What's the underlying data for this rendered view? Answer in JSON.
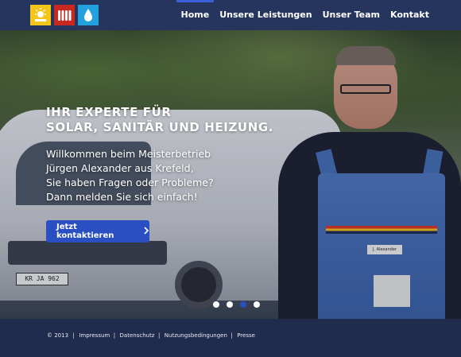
{
  "nav": {
    "logo_icons": [
      "sun-icon",
      "radiator-icon",
      "water-drop-icon"
    ],
    "logo_colors": [
      "#f4c61a",
      "#c8281f",
      "#22a1dd"
    ],
    "items": [
      {
        "label": "Home",
        "active": true
      },
      {
        "label": "Unsere Leistungen",
        "active": false
      },
      {
        "label": "Unser Team",
        "active": false
      },
      {
        "label": "Kontakt",
        "active": false
      }
    ]
  },
  "hero": {
    "headline_line1": "IHR EXPERTE FÜR",
    "headline_line2": "SOLAR, SANITÄR UND HEIZUNG.",
    "intro_line1": "Willkommen beim Meisterbetrieb",
    "intro_line2": "Jürgen Alexander aus Krefeld,",
    "intro_line3": "Sie haben Fragen oder Probleme?",
    "intro_line4": "Dann melden Sie sich einfach!",
    "cta_label": "Jetzt kontaktieren",
    "cta_icon": "chevron-right-icon",
    "license_plate": "KR JA 962",
    "name_tag": "J. Alexander",
    "slider_active_index": 2,
    "slider_count": 4
  },
  "footer": {
    "copyright": "© 2013",
    "links": [
      "Impressum",
      "Datenschutz",
      "Nutzungsbedingungen",
      "Presse"
    ]
  },
  "colors": {
    "nav_bg": "#25355e",
    "footer_bg": "#1f2c4d",
    "accent": "#2a4fc2"
  }
}
